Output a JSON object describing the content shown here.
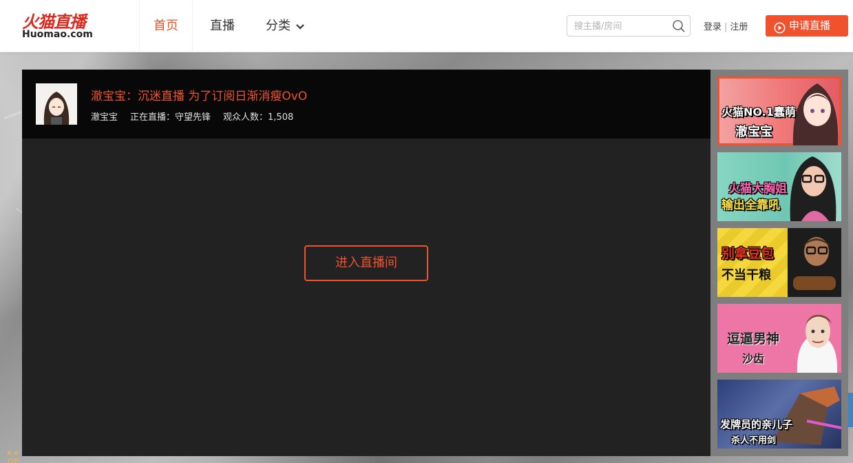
{
  "header": {
    "logo": {
      "cn": "火猫直播",
      "en": "Huomao.com"
    },
    "nav": [
      {
        "label": "首页"
      },
      {
        "label": "直播"
      },
      {
        "label": "分类"
      }
    ],
    "search": {
      "placeholder": "搜主播/房间",
      "value": ""
    },
    "login_label": "登录",
    "separator": "|",
    "register_label": "注册",
    "apply_label": "申请直播"
  },
  "player": {
    "title": "澈宝宝：沉迷直播 为了订阅日渐消瘦OvO",
    "streamer": "澈宝宝",
    "game": "正在直播：守望先锋",
    "viewers": "观众人数：1,508",
    "enter_label": "进入直播间"
  },
  "rail": {
    "items": [
      {
        "line1": "火猫NO.1蠢萌",
        "line2": "澈宝宝",
        "bg": "#f07a7a"
      },
      {
        "line1": "火猫大胸姐",
        "line2": "输出全靠吼",
        "bg": "#6fc7b3"
      },
      {
        "line1": "别拿豆包",
        "line2": "不当干粮",
        "bg": "#f2d43a"
      },
      {
        "line1": "逗逼男神",
        "line2": "沙齿",
        "bg": "#ee76a6"
      },
      {
        "line1": "发牌员的亲儿子",
        "line2": "杀人不用剑",
        "bg": "#3c4f8a"
      }
    ]
  },
  "colors": {
    "accent": "#f0522d",
    "header_bg": "#ffffff",
    "player_bg": "#222222",
    "player_head_bg": "#080808"
  }
}
